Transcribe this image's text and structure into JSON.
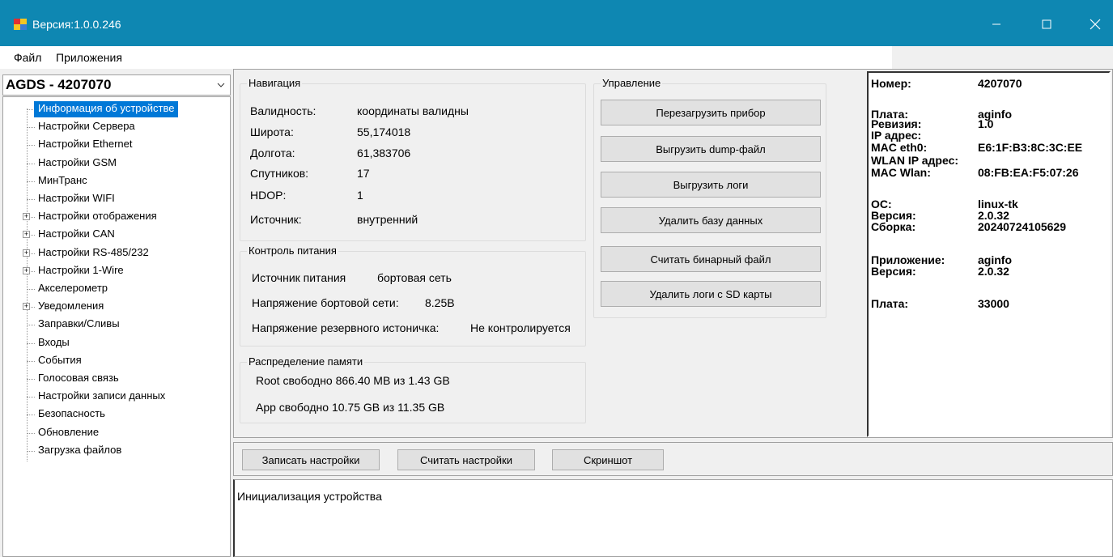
{
  "window": {
    "title": "Версия:1.0.0.246",
    "icons": {
      "app": "app-grid-icon",
      "minimize": "minimize-icon",
      "maximize": "maximize-icon",
      "close": "close-icon"
    },
    "accent": "#0e87b2"
  },
  "menu": {
    "file": "Файл",
    "apps": "Приложения"
  },
  "device_combo": {
    "value": "AGDS - 4207070"
  },
  "tree": {
    "items": [
      {
        "label": "Информация об устройстве",
        "selected": true,
        "expandable": false
      },
      {
        "label": "Настройки Сервера",
        "expandable": false
      },
      {
        "label": "Настройки Ethernet",
        "expandable": false
      },
      {
        "label": "Настройки GSM",
        "expandable": false
      },
      {
        "label": "МинТранс",
        "expandable": false
      },
      {
        "label": "Настройки WIFI",
        "expandable": false
      },
      {
        "label": "Настройки отображения",
        "expandable": true
      },
      {
        "label": "Настройки CAN",
        "expandable": true
      },
      {
        "label": "Настройки RS-485/232",
        "expandable": true
      },
      {
        "label": "Настройки 1-Wire",
        "expandable": true
      },
      {
        "label": "Акселерометр",
        "expandable": false
      },
      {
        "label": "Уведомления",
        "expandable": true
      },
      {
        "label": "Заправки/Сливы",
        "expandable": false
      },
      {
        "label": "Входы",
        "expandable": false
      },
      {
        "label": "События",
        "expandable": false
      },
      {
        "label": "Голосовая связь",
        "expandable": false
      },
      {
        "label": "Настройки записи данных",
        "expandable": false
      },
      {
        "label": "Безопасность",
        "expandable": false
      },
      {
        "label": "Обновление",
        "expandable": false
      },
      {
        "label": "Загрузка файлов",
        "expandable": false
      }
    ]
  },
  "navigation": {
    "title": "Навигация",
    "rows": [
      {
        "label": "Валидность:",
        "value": "координаты валидны"
      },
      {
        "label": "Широта:",
        "value": "55,174018"
      },
      {
        "label": "Долгота:",
        "value": "61,383706"
      },
      {
        "label": "Спутников:",
        "value": "17"
      },
      {
        "label": "HDOP:",
        "value": "1"
      },
      {
        "label": "Источник:",
        "value": "внутренний"
      }
    ]
  },
  "power": {
    "title": "Контроль питания",
    "source_label": "Источник питания",
    "source_value": "бортовая сеть",
    "board_label": "Напряжение бортовой сети:",
    "board_value": "8.25В",
    "backup_label": "Напряжение резервного истоничка:",
    "backup_value": "Не контролируется"
  },
  "memory": {
    "title": "Распределение памяти",
    "root": "Root свободно 866.40 MB из 1.43 GB",
    "app": "App свободно 10.75 GB из 11.35 GB"
  },
  "control": {
    "title": "Управление",
    "buttons": [
      "Перезагрузить прибор",
      "Выгрузить dump-файл",
      "Выгрузить логи",
      "Удалить базу данных",
      "Считать бинарный файл",
      "Удалить логи с SD карты"
    ]
  },
  "info": {
    "number_label": "Номер:",
    "number_value": "4207070",
    "board_label": "Плата:",
    "board_value": "aginfo",
    "revision_label": "Ревизия:",
    "revision_value": "1.0",
    "ip_label": "IP адрес:",
    "ip_value": "",
    "mac_eth_label": "MAC eth0:",
    "mac_eth_value": "E6:1F:B3:8C:3C:EE",
    "wlan_ip_label": "WLAN IP адрес:",
    "wlan_ip_value": "",
    "mac_wlan_label": "MAC Wlan:",
    "mac_wlan_value": "08:FB:EA:F5:07:26",
    "os_label": "ОС:",
    "os_value": "linux-tk",
    "os_version_label": "Версия:",
    "os_version_value": "2.0.32",
    "build_label": "Сборка:",
    "build_value": "20240724105629",
    "app_label": "Приложение:",
    "app_value": "aginfo",
    "app_version_label": "Версия:",
    "app_version_value": "2.0.32",
    "board2_label": "Плата:",
    "board2_value": "33000"
  },
  "bottom_buttons": {
    "write": "Записать настройки",
    "read": "Считать настройки",
    "screenshot": "Скриншот"
  },
  "log": {
    "line1": "Инициализация устройства"
  }
}
